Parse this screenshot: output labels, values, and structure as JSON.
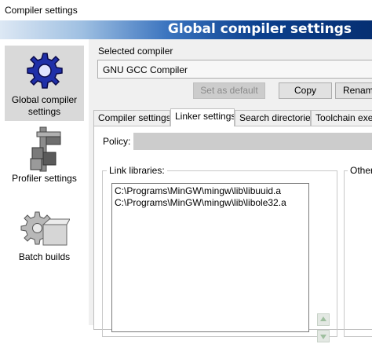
{
  "window": {
    "title": "Compiler settings"
  },
  "header": {
    "title": "Global compiler settings"
  },
  "sidebar": {
    "items": [
      {
        "label_line1": "Global compiler",
        "label_line2": "settings",
        "icon": "gear-icon",
        "selected": true
      },
      {
        "label": "Profiler settings",
        "icon": "caliper-icon"
      },
      {
        "label": "Batch builds",
        "icon": "gear-box-icon"
      }
    ]
  },
  "compiler": {
    "group_label": "Selected compiler",
    "selected": "GNU GCC Compiler",
    "buttons": {
      "set_default": "Set as default",
      "copy": "Copy",
      "rename": "Rename"
    }
  },
  "tabs": [
    {
      "label": "Compiler settings"
    },
    {
      "label": "Linker settings",
      "active": true
    },
    {
      "label": "Search directories"
    },
    {
      "label": "Toolchain executables"
    }
  ],
  "linker": {
    "policy_label": "Policy:",
    "link_libraries_label": "Link libraries:",
    "libraries": [
      "C:\\Programs\\MinGW\\mingw\\lib\\libuuid.a",
      "C:\\Programs\\MinGW\\mingw\\lib\\libole32.a"
    ],
    "other_label": "Other"
  },
  "colors": {
    "header_dark": "#062f72",
    "selected_bg": "#d9d9d9",
    "gear_blue": "#1f2fa8"
  }
}
